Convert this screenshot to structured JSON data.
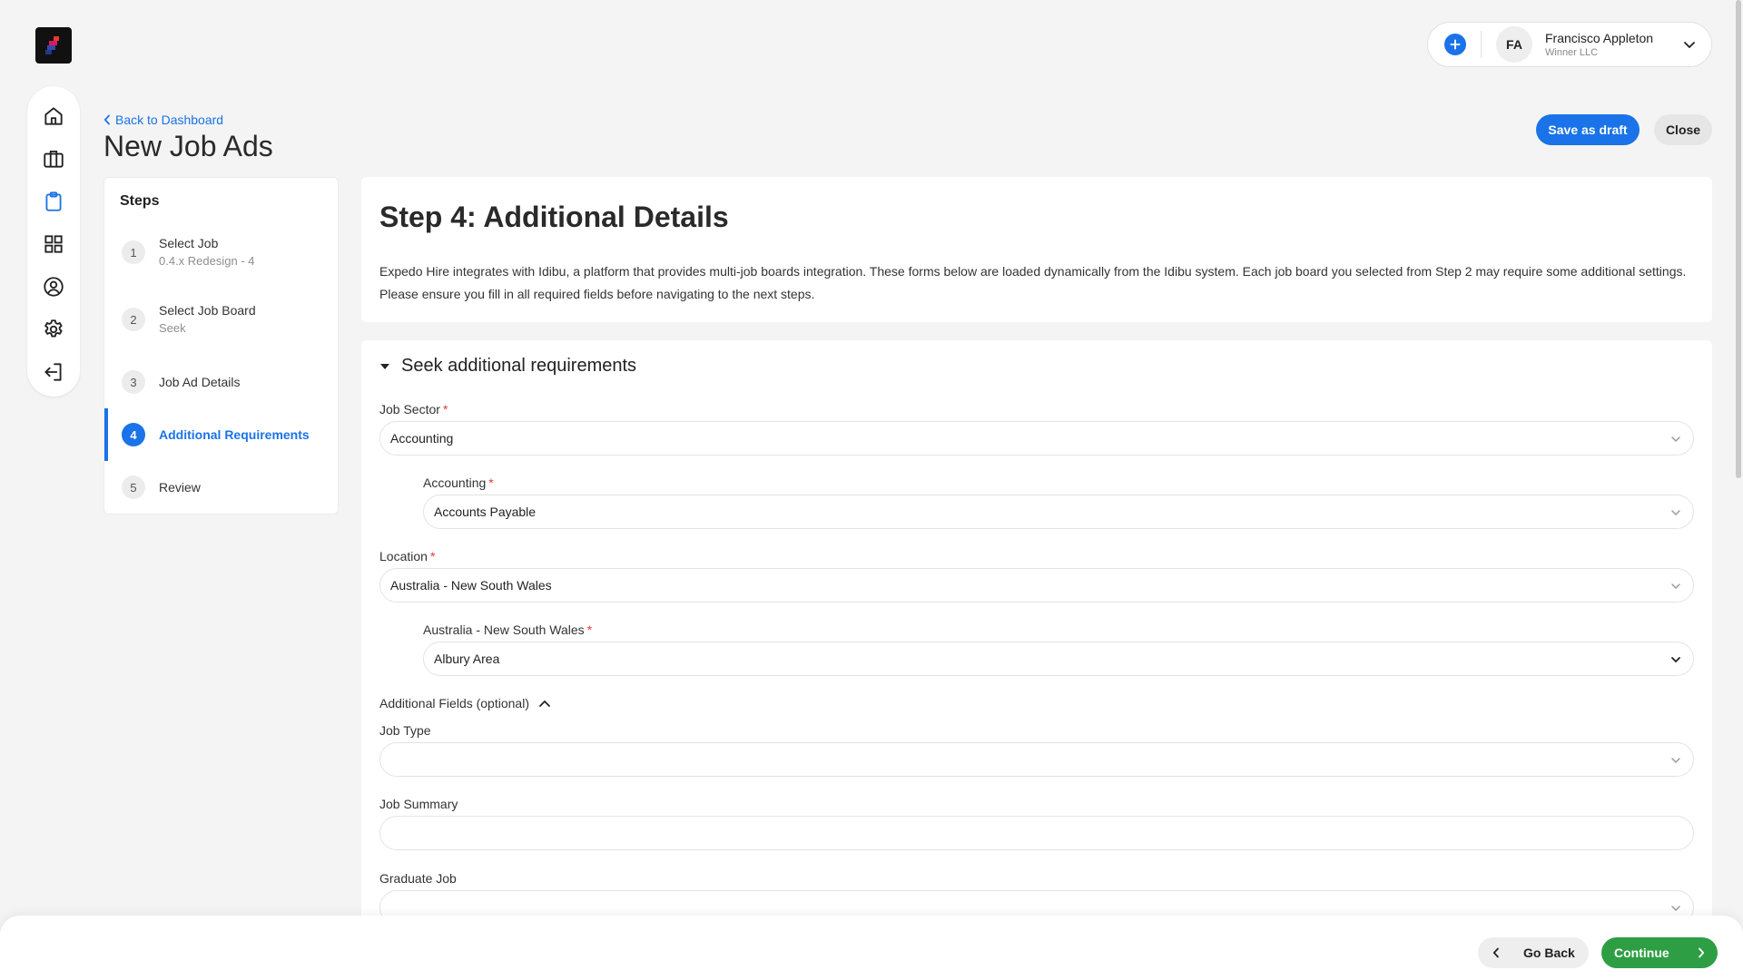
{
  "colors": {
    "accent": "#1a73e8",
    "success": "#2e9e44",
    "required": "#e53935",
    "page_bg": "#f4f4f4"
  },
  "nav": {
    "items": [
      {
        "icon": "home-icon"
      },
      {
        "icon": "briefcase-icon"
      },
      {
        "icon": "clipboard-icon",
        "active": true
      },
      {
        "icon": "grid-icon"
      },
      {
        "icon": "user-pin-icon"
      },
      {
        "icon": "gear-icon"
      },
      {
        "icon": "logout-icon"
      }
    ]
  },
  "user": {
    "initials": "FA",
    "name": "Francisco Appleton",
    "company": "Winner LLC"
  },
  "header": {
    "back_label": "Back to Dashboard",
    "title": "New Job Ads",
    "save_draft_label": "Save as draft",
    "close_label": "Close"
  },
  "steps": {
    "heading": "Steps",
    "items": [
      {
        "num": "1",
        "label": "Select Job",
        "sub": "0.4.x Redesign - 4"
      },
      {
        "num": "2",
        "label": "Select Job Board",
        "sub": "Seek"
      },
      {
        "num": "3",
        "label": "Job Ad Details"
      },
      {
        "num": "4",
        "label": "Additional Requirements",
        "active": true
      },
      {
        "num": "5",
        "label": "Review"
      }
    ]
  },
  "intro": {
    "title": "Step 4: Additional Details",
    "description": "Expedo Hire integrates with Idibu, a platform that provides multi-job boards integration. These forms below are loaded dynamically from the Idibu system. Each job board you selected from Step 2 may require some additional settings. Please ensure you fill in all required fields before navigating to the next steps."
  },
  "form": {
    "section_title": "Seek additional requirements",
    "job_sector": {
      "label": "Job Sector",
      "value": "Accounting"
    },
    "accounting": {
      "label": "Accounting",
      "value": "Accounts Payable"
    },
    "location": {
      "label": "Location",
      "value": "Australia - New South Wales"
    },
    "nsw_area": {
      "label": "Australia - New South Wales",
      "value": "Albury Area"
    },
    "optional_toggle": "Additional Fields (optional)",
    "job_type": {
      "label": "Job Type",
      "value": ""
    },
    "job_summary": {
      "label": "Job Summary",
      "value": ""
    },
    "graduate_job": {
      "label": "Graduate Job",
      "value": ""
    }
  },
  "footer": {
    "go_back_label": "Go Back",
    "continue_label": "Continue"
  }
}
